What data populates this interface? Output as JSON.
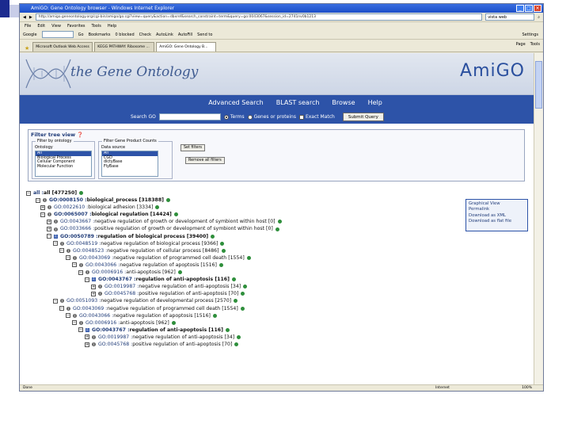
{
  "browser": {
    "title": "AmiGO: Gene Ontology browser - Windows Internet Explorer",
    "address": "http://amigo.geneontology.org/cgi-bin/amigo/go.cgi?view=query&action=dbxref&search_constraint=term&query=go:0043067&session_id=2741nv0b1213",
    "search_text": "vista web",
    "menu": [
      "File",
      "Edit",
      "View",
      "Favorites",
      "Tools",
      "Help"
    ],
    "links": [
      "Google",
      "Go",
      "Bookmarks",
      "0 blocked",
      "Check",
      "AutoLink",
      "AutoFill",
      "Send to",
      "Settings"
    ],
    "tabs": [
      "Microsoft Outlook Web Access",
      "KEGG PATHWAY: Ribosome ...",
      "AmiGO: Gene Ontology B..."
    ],
    "tab_tools": [
      "Page",
      "Tools"
    ],
    "settings_label": "Settings",
    "status": "Done",
    "zone": "Internet",
    "zoom": "100%"
  },
  "amigo": {
    "site_title": "the Gene Ontology",
    "logo": "AmiGO",
    "nav": [
      "Advanced Search",
      "BLAST search",
      "Browse",
      "Help"
    ],
    "search_label": "Search GO",
    "options": [
      "Terms",
      "Genes or proteins",
      "Exact Match"
    ],
    "submit": "Submit Query",
    "filter": {
      "title": "Filter tree view",
      "by_ontology": "Filter by ontology",
      "ontology_label": "Ontology",
      "ontologies": [
        "All",
        "Biological Process",
        "Cellular Component",
        "Molecular Function"
      ],
      "gp_counts": "Filter Gene Product Counts",
      "data_source_label": "Data source",
      "sources": [
        "All",
        "CGD",
        "dictyBase",
        "FlyBase"
      ],
      "set_filters": "Set filters",
      "remove_filters": "Remove all filters"
    },
    "tree": [
      {
        "prefix": "all : ",
        "label": "all [477250]",
        "bold": true
      },
      {
        "prefix": "GO:0008150 : ",
        "label": "biological_process [318388]",
        "bold": true
      },
      {
        "prefix": "GO:0022610 : ",
        "label": "biological adhesion [3334]",
        "bold": false
      },
      {
        "prefix": "GO:0065007 : ",
        "label": "biological regulation [14424]",
        "bold": true
      },
      {
        "prefix": "GO:0043667 : ",
        "label": "negative regulation of growth or development of symbiont within host [0]",
        "bold": false
      },
      {
        "prefix": "GO:0033666 : ",
        "label": "positive regulation of growth or development of symbiont within host [0]",
        "bold": false
      },
      {
        "prefix": "GO:0050789 : ",
        "label": "regulation of biological process [39400]",
        "bold": true
      },
      {
        "prefix": "GO:0048519 : ",
        "label": "negative regulation of biological process [9366]",
        "bold": false
      },
      {
        "prefix": "GO:0048523 : ",
        "label": "negative regulation of cellular process [8486]",
        "bold": false
      },
      {
        "prefix": "GO:0043069 : ",
        "label": "negative regulation of programmed cell death [1554]",
        "bold": false
      },
      {
        "prefix": "GO:0043066 : ",
        "label": "negative regulation of apoptosis [1516]",
        "bold": false
      },
      {
        "prefix": "GO:0006916 : ",
        "label": "anti-apoptosis [962]",
        "bold": false
      },
      {
        "prefix": "GO:0043767 : ",
        "label": "regulation of anti-apoptosis [116]",
        "bold": true
      },
      {
        "prefix": "GO:0019987 : ",
        "label": "negative regulation of anti-apoptosis [34]",
        "bold": false
      },
      {
        "prefix": "GO:0045768 : ",
        "label": "positive regulation of anti-apoptosis [70]",
        "bold": false
      },
      {
        "prefix": "GO:0051093 : ",
        "label": "negative regulation of developmental process [2570]",
        "bold": false
      },
      {
        "prefix": "GO:0043069 : ",
        "label": "negative regulation of programmed cell death [1554]",
        "bold": false
      },
      {
        "prefix": "GO:0043066 : ",
        "label": "negative regulation of apoptosis [1516]",
        "bold": false
      },
      {
        "prefix": "GO:0006916 : ",
        "label": "anti-apoptosis [962]",
        "bold": false
      },
      {
        "prefix": "GO:0043767 : ",
        "label": "regulation of anti-apoptosis [116]",
        "bold": true
      },
      {
        "prefix": "GO:0019987 : ",
        "label": "negative regulation of anti-apoptosis [34]",
        "bold": false
      },
      {
        "prefix": "GO:0045768 : ",
        "label": "positive regulation of anti-apoptosis [70]",
        "bold": false
      }
    ],
    "sidebox": [
      "Graphical View",
      "Permalink",
      "Download as XML",
      "Download as flat file"
    ]
  }
}
